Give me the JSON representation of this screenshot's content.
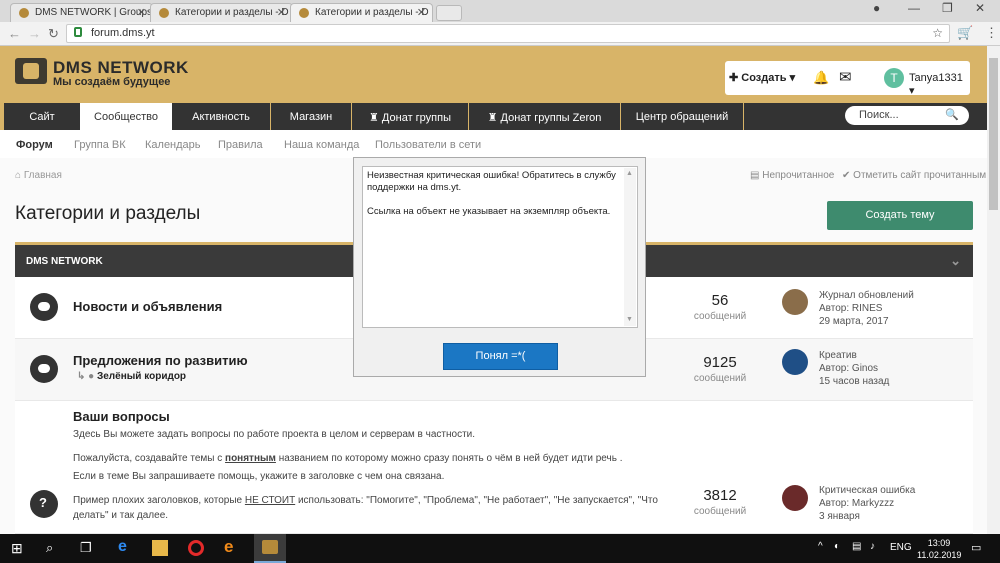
{
  "browser": {
    "tabs": [
      {
        "label": "DMS NETWORK | Groups"
      },
      {
        "label": "Категории и разделы - D"
      },
      {
        "label": "Категории и разделы - D"
      }
    ],
    "url": "forum.dms.yt"
  },
  "site": {
    "brand": "DMS NETWORK",
    "slogan": "Мы создаём будущее",
    "create_label": "Создать",
    "avatar_letter": "T",
    "username": "Tanya1331",
    "accent_color": "#d8b468"
  },
  "mainnav": [
    {
      "label": "Сайт"
    },
    {
      "label": "Сообщество"
    },
    {
      "label": "Активность"
    },
    {
      "label": "Магазин"
    },
    {
      "label": "Донат группы"
    },
    {
      "label": "Донат группы Zeron"
    },
    {
      "label": "Центр обращений"
    }
  ],
  "search_placeholder": "Поиск...",
  "subnav": [
    {
      "label": "Форум"
    },
    {
      "label": "Группа ВК"
    },
    {
      "label": "Календарь"
    },
    {
      "label": "Правила"
    },
    {
      "label": "Наша команда"
    },
    {
      "label": "Пользователи в сети"
    }
  ],
  "breadcrumb": "Главная",
  "actions": {
    "unread": "Непрочитанное",
    "mark_read": "Отметить сайт прочитанным"
  },
  "page_title": "Категории и разделы",
  "new_thread": "Создать тему",
  "block_title": "DMS NETWORK",
  "forums": [
    {
      "title": "Новости и объявления",
      "count": "56",
      "count_label": "сообщений",
      "last_title": "Журнал обновлений",
      "last_author": "Автор: RINES",
      "last_date": "29 марта, 2017"
    },
    {
      "title": "Предложения по развитию",
      "subforum": "Зелёный коридор",
      "count": "9125",
      "count_label": "сообщений",
      "last_title": "Креатив",
      "last_author": "Автор: Ginos",
      "last_date": "15 часов назад"
    },
    {
      "title": "Ваши вопросы",
      "desc1": "Здесь Вы можете задать вопросы по работе проекта в целом и серверам в частности.",
      "desc2a": "Пожалуйста, создавайте темы с ",
      "desc2b": "понятным",
      "desc2c": " названием по которому можно сразу понять о чём в ней будет идти речь .",
      "desc3": "Если в теме Вы запрашиваете помощь, укажите в заголовке с чем она связана.",
      "desc4a": "Пример плохих заголовков, которые ",
      "desc4b": "НЕ СТОИТ",
      "desc4c": " использовать: \"Помогите\",  \"Проблема\", \"Не работает\", \"Не запускается\", \"Что",
      "desc5": "делать\" и так далее.",
      "count": "3812",
      "count_label": "сообщений",
      "last_title": "Критическая ошибка",
      "last_author": "Автор: Markyzzz",
      "last_date": "3 января"
    }
  ],
  "dialog": {
    "line1": "Неизвестная критическая ошибка! Обратитесь в службу",
    "line2": "поддержки на dms.yt.",
    "line3": "Ссылка на объект не указывает на экземпляр объекта.",
    "button": "Понял =*("
  },
  "taskbar": {
    "lang": "ENG",
    "time": "13:09",
    "date": "11.02.2019"
  }
}
